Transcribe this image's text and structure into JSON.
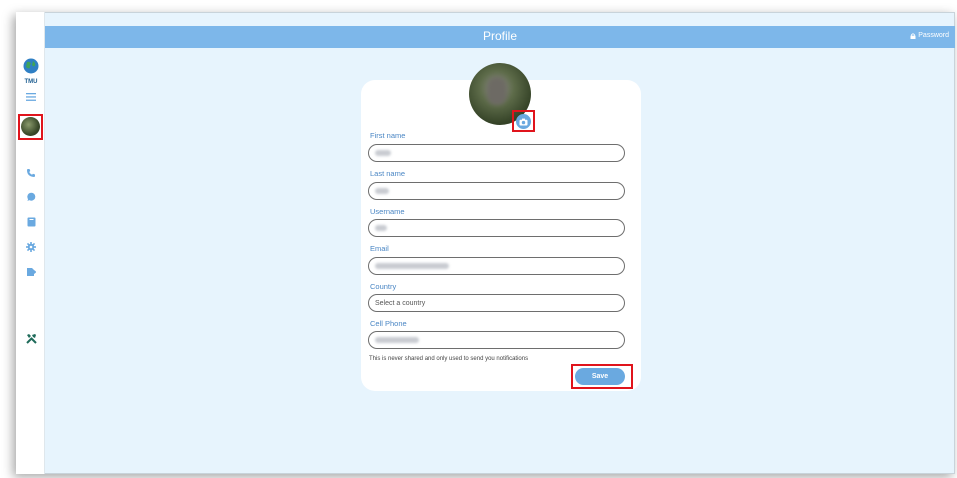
{
  "header": {
    "title": "Profile",
    "password_label": "Password",
    "color": "#7db7ea"
  },
  "sidebar": {
    "logo_text": "TMU",
    "items": [
      {
        "name": "menu-icon"
      },
      {
        "name": "avatar"
      },
      {
        "name": "phone-icon"
      },
      {
        "name": "chat-icon"
      },
      {
        "name": "book-icon"
      },
      {
        "name": "gear-icon"
      },
      {
        "name": "file-export-icon"
      },
      {
        "name": "tools-icon"
      }
    ]
  },
  "form": {
    "fields": [
      {
        "label": "First name",
        "placeholder": ""
      },
      {
        "label": "Last name",
        "placeholder": ""
      },
      {
        "label": "Username",
        "placeholder": ""
      },
      {
        "label": "Email",
        "placeholder": ""
      },
      {
        "label": "Country",
        "placeholder": "Select a country"
      },
      {
        "label": "Cell Phone",
        "placeholder": ""
      }
    ],
    "helper_text": "This is never shared and only used to send you notifications",
    "save_label": "Save"
  },
  "colors": {
    "accent": "#6aa9e0",
    "highlight": "#e0141c",
    "background": "#e7f4fd"
  }
}
